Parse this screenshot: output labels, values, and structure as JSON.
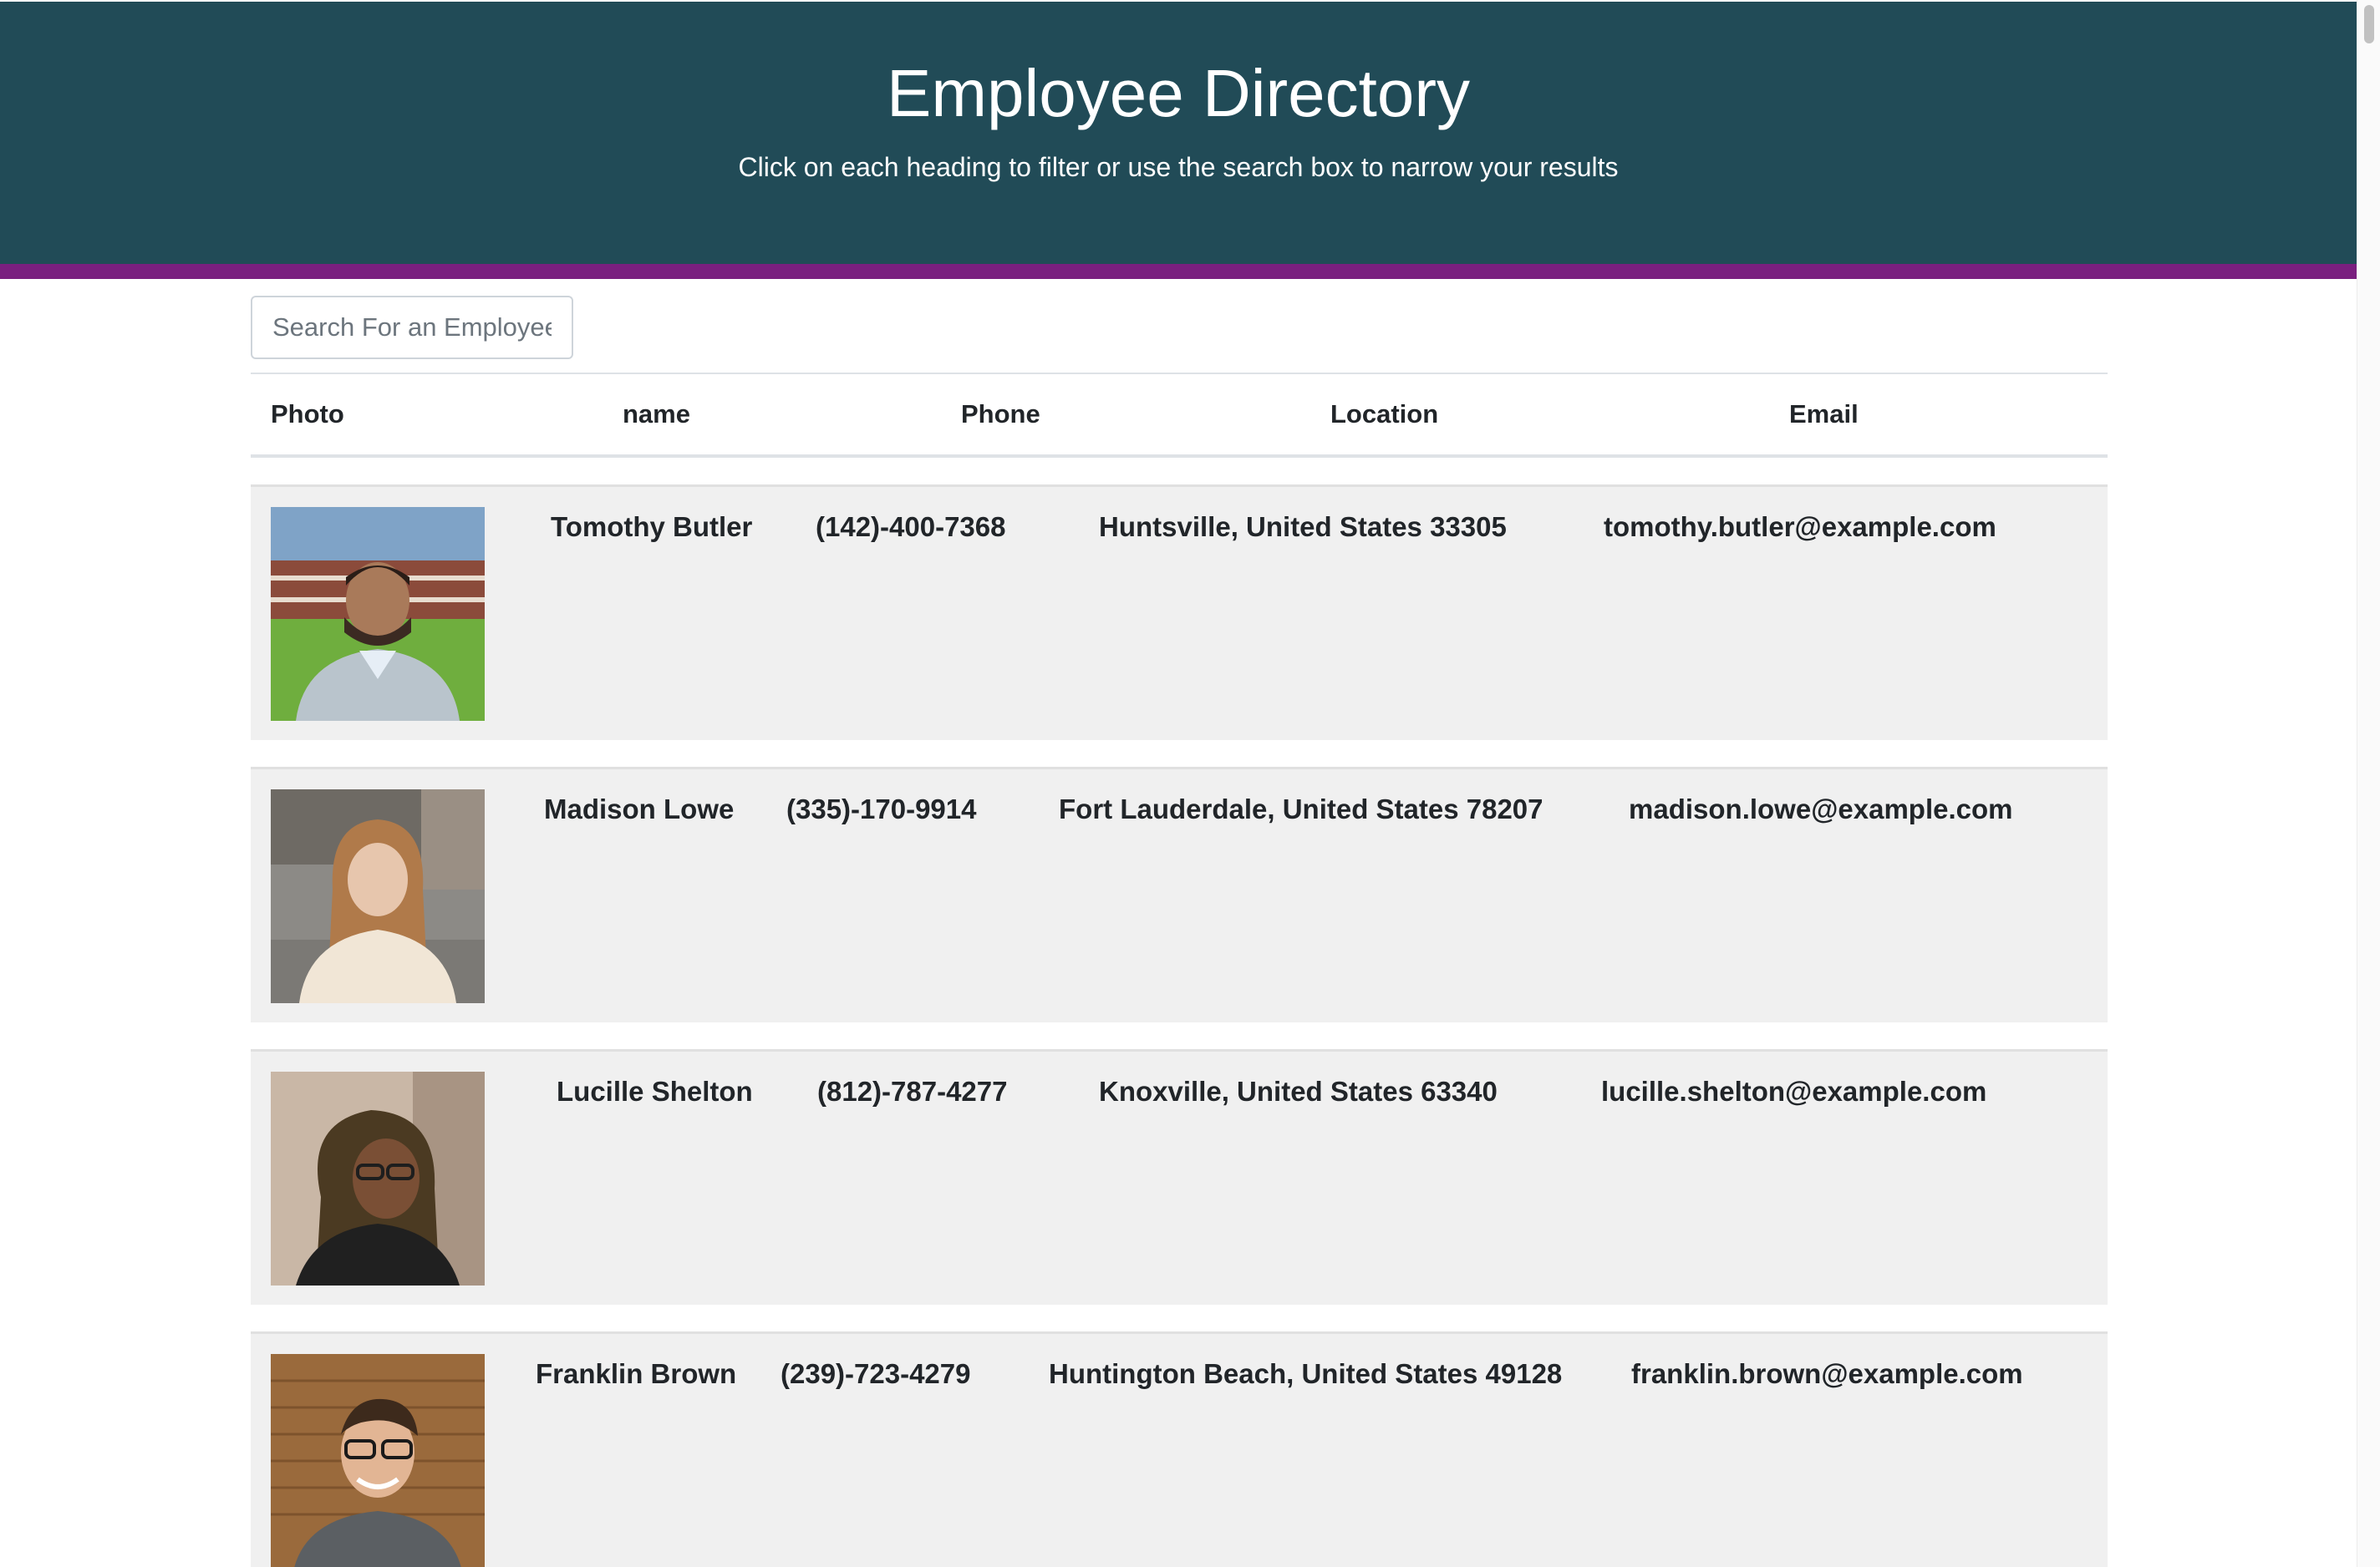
{
  "header": {
    "title": "Employee Directory",
    "subtitle": "Click on each heading to filter or use the search box to narrow your results"
  },
  "search": {
    "placeholder": "Search For an Employee"
  },
  "table": {
    "columns": [
      "Photo",
      "name",
      "Phone",
      "Location",
      "Email"
    ],
    "rows": [
      {
        "name": "Tomothy Butler",
        "phone": "(142)-400-7368",
        "location": "Huntsville, United States 33305",
        "email": "tomothy.butler@example.com"
      },
      {
        "name": "Madison Lowe",
        "phone": "(335)-170-9914",
        "location": "Fort Lauderdale, United States 78207",
        "email": "madison.lowe@example.com"
      },
      {
        "name": "Lucille Shelton",
        "phone": "(812)-787-4277",
        "location": "Knoxville, United States 63340",
        "email": "lucille.shelton@example.com"
      },
      {
        "name": "Franklin Brown",
        "phone": "(239)-723-4279",
        "location": "Huntington Beach, United States 49128",
        "email": "franklin.brown@example.com"
      }
    ]
  },
  "colors": {
    "header_bg": "#214b57",
    "accent_bar": "#7a1f7f",
    "row_bg": "#f0f0f0"
  }
}
